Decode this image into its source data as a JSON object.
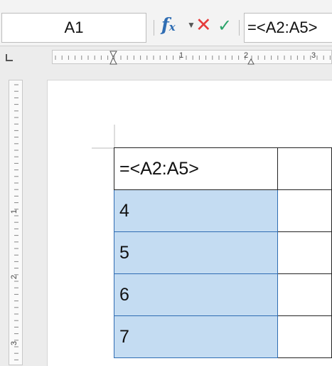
{
  "formula_bar": {
    "name_box_value": "A1",
    "formula_value": "=<A2:A5>",
    "icons": {
      "function_wizard": "fx-icon",
      "function_dropdown": "chevron-down-icon",
      "cancel": "close-icon",
      "accept": "checkmark-icon"
    }
  },
  "rulers": {
    "horizontal_labels": [
      "1",
      "2",
      "3"
    ],
    "vertical_labels": [
      "1",
      "2",
      "3"
    ]
  },
  "table": {
    "rows": [
      {
        "value": "=<A2:A5>",
        "selected": false
      },
      {
        "value": "4",
        "selected": true
      },
      {
        "value": "5",
        "selected": true
      },
      {
        "value": "6",
        "selected": true
      },
      {
        "value": "7",
        "selected": true
      }
    ]
  },
  "colors": {
    "selection": "#c4dcf2",
    "selection_border": "#2f6db3",
    "cancel": "#e53b3b",
    "accept": "#2aa36a",
    "fx": "#2f6db3"
  }
}
